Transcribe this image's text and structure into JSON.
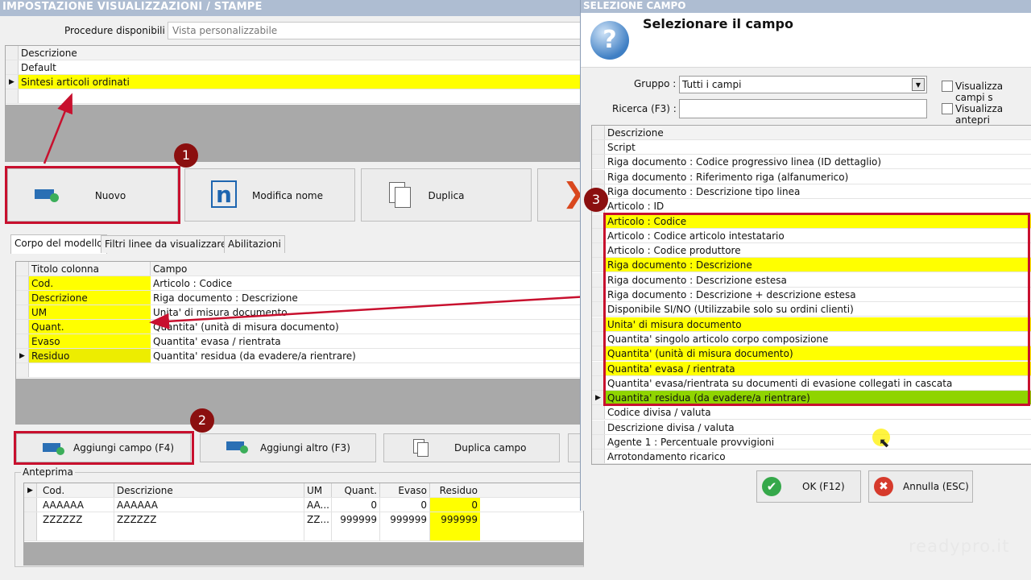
{
  "main": {
    "title": "IMPOSTAZIONE VISUALIZZAZIONI / STAMPE",
    "procedure_label": "Procedure disponibili :",
    "procedure_value": "Vista personalizzabile",
    "views_header": "Descrizione",
    "views": [
      "Default",
      "Sintesi articoli ordinati"
    ],
    "buttons": {
      "new": "Nuovo",
      "rename": "Modifica nome",
      "duplicate": "Duplica"
    },
    "tabs": [
      "Corpo del modello",
      "Filtri linee da visualizzare",
      "Abilitazioni"
    ],
    "columns_header": {
      "title": "Titolo colonna",
      "field": "Campo"
    },
    "columns": [
      {
        "title": "Cod.",
        "field": "Articolo : Codice"
      },
      {
        "title": "Descrizione",
        "field": "Riga documento : Descrizione"
      },
      {
        "title": "UM",
        "field": "Unita' di misura documento"
      },
      {
        "title": "Quant.",
        "field": "Quantita' (unità di misura documento)"
      },
      {
        "title": "Evaso",
        "field": "Quantita' evasa / rientrata"
      },
      {
        "title": "Residuo",
        "field": "Quantita' residua (da evadere/a rientrare)"
      }
    ],
    "field_buttons": {
      "add_field": "Aggiungi campo (F4)",
      "add_other": "Aggiungi altro (F3)",
      "dup_field": "Duplica campo"
    },
    "preview_label": "Anteprima",
    "preview_headers": [
      "Cod.",
      "Descrizione",
      "UM",
      "Quant.",
      "Evaso",
      "Residuo"
    ],
    "preview_rows": [
      [
        "AAAAAA",
        "AAAAAA",
        "AA...",
        "0",
        "0",
        "0"
      ],
      [
        "ZZZZZZ",
        "ZZZZZZ",
        "ZZ...",
        "999999",
        "999999",
        "999999"
      ]
    ]
  },
  "dialog": {
    "title": "SELEZIONE CAMPO",
    "heading": "Selezionare il campo",
    "group_label": "Gruppo :",
    "group_value": "Tutti i campi",
    "search_label": "Ricerca (F3) :",
    "search_value": "",
    "check1": "Visualizza campi s",
    "check2": "Visualizza antepri",
    "list_header": "Descrizione",
    "fields": [
      "Script",
      "Riga documento : Codice progressivo linea (ID dettaglio)",
      "Riga documento : Riferimento riga (alfanumerico)",
      "Riga documento : Descrizione tipo linea",
      "Articolo : ID",
      "Articolo : Codice",
      "Articolo : Codice articolo intestatario",
      "Articolo : Codice produttore",
      "Riga documento : Descrizione",
      "Riga documento : Descrizione estesa",
      "Riga documento : Descrizione + descrizione estesa",
      "Disponibile SI/NO (Utilizzabile solo su ordini clienti)",
      "Unita' di misura documento",
      "Quantita' singolo articolo corpo composizione",
      "Quantita' (unità di misura documento)",
      "Quantita' evasa / rientrata",
      "Quantita' evasa/rientrata su documenti di evasione collegati in cascata",
      "Quantita' residua (da evadere/a rientrare)",
      "Codice divisa / valuta",
      "Descrizione divisa / valuta",
      "Agente 1 : Percentuale provvigioni",
      "Arrotondamento ricarico"
    ],
    "ok": "OK (F12)",
    "cancel": "Annulla (ESC)"
  },
  "badges": [
    "1",
    "2",
    "3"
  ],
  "watermark": "readypro.it",
  "colors": {
    "highlight": "#ffff00",
    "selected": "#8fd400",
    "annotation": "#c8102e"
  }
}
